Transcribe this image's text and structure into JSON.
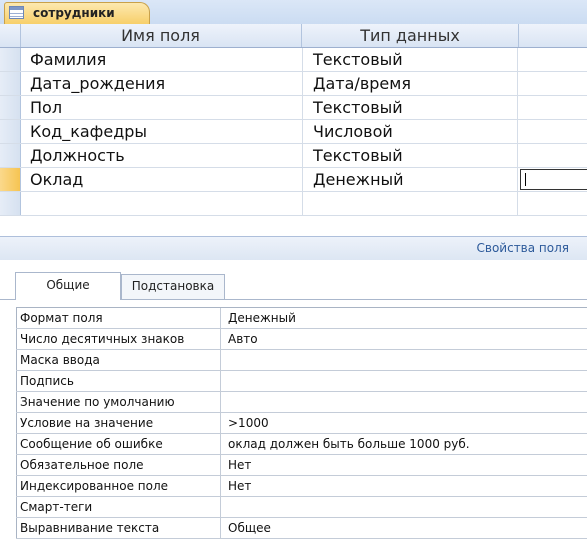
{
  "object_tab": {
    "title": "сотрудники",
    "icon": "table-icon"
  },
  "grid": {
    "columns": {
      "name": "Имя поля",
      "type": "Тип данных"
    },
    "rows": [
      {
        "name": "Фамилия",
        "type": "Текстовый"
      },
      {
        "name": "Дата_рождения",
        "type": "Дата/время"
      },
      {
        "name": "Пол",
        "type": "Текстовый"
      },
      {
        "name": "Код_кафедры",
        "type": "Числовой"
      },
      {
        "name": "Должность",
        "type": "Текстовый"
      },
      {
        "name": "Оклад",
        "type": "Денежный"
      }
    ]
  },
  "properties": {
    "title": "Свойства поля",
    "tabs": [
      "Общие",
      "Подстановка"
    ],
    "rows": [
      {
        "label": "Формат поля",
        "value": "Денежный"
      },
      {
        "label": "Число десятичных знаков",
        "value": "Авто"
      },
      {
        "label": "Маска ввода",
        "value": ""
      },
      {
        "label": "Подпись",
        "value": ""
      },
      {
        "label": "Значение по умолчанию",
        "value": ""
      },
      {
        "label": "Условие на значение",
        "value": ">1000"
      },
      {
        "label": "Сообщение об ошибке",
        "value": "оклад должен быть больше 1000 руб."
      },
      {
        "label": "Обязательное поле",
        "value": "Нет"
      },
      {
        "label": "Индексированное поле",
        "value": "Нет"
      },
      {
        "label": "Смарт-теги",
        "value": ""
      },
      {
        "label": "Выравнивание текста",
        "value": "Общее"
      }
    ]
  }
}
